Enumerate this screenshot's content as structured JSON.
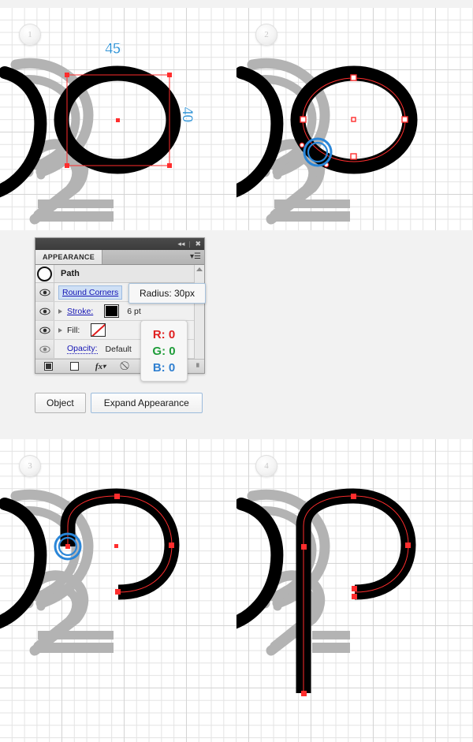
{
  "steps": [
    {
      "number": "1"
    },
    {
      "number": "2"
    },
    {
      "number": "3"
    },
    {
      "number": "4"
    }
  ],
  "measurements": {
    "width_label": "45",
    "height_label": "40"
  },
  "appearance_panel": {
    "titlebar": {
      "collapse_icon": "collapse-double-arrow-icon",
      "close_icon": "close-icon"
    },
    "tab_label": "APPEARANCE",
    "menu_icon": "panel-menu-icon",
    "target_label": "Path",
    "rows": [
      {
        "label": "Round Corners",
        "value": ""
      },
      {
        "label": "Stroke:",
        "value": "6 pt"
      },
      {
        "label": "Fill:",
        "value": ""
      },
      {
        "label": "Opacity:",
        "value": "Default"
      }
    ],
    "footer": {
      "new_fill_icon": "new-fill-icon",
      "new_stroke_icon": "new-stroke-icon",
      "add_effect_icon": "add-effect-fx-icon",
      "clear_appearance_icon": "clear-appearance-icon",
      "resize_grip_icon": "resize-grip-icon"
    }
  },
  "tooltips": {
    "radius": "Radius: 30px",
    "rgb": {
      "r": "R: 0",
      "g": "G: 0",
      "b": "B: 0"
    }
  },
  "buttons": {
    "object": "Object",
    "expand_appearance": "Expand Appearance"
  },
  "colors": {
    "selection_red": "#ff2d2d",
    "highlight_blue": "#2f93d6",
    "artwork_black": "#000000",
    "ghost_gray": "#b0b0b0",
    "panel_bg": "#f0f0f0",
    "link_blue": "#1414b4"
  }
}
